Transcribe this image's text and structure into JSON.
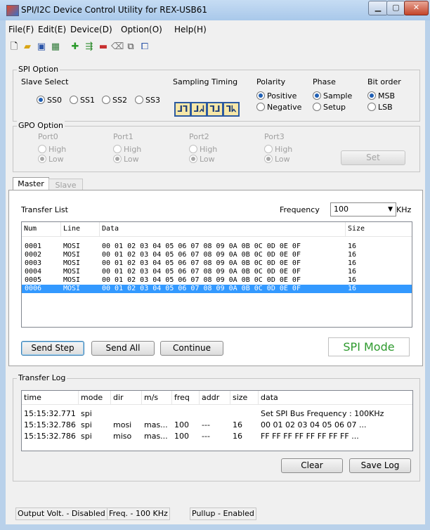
{
  "window": {
    "title": "SPI/I2C Device Control Utility for REX-USB61"
  },
  "menu": [
    "File(F)",
    "Edit(E)",
    "Device(D)",
    "Option(O)",
    "Help(H)"
  ],
  "toolbar_icons": [
    "new-file-icon",
    "open-folder-icon",
    "save-icon",
    "device-icon",
    "add-icon",
    "insert-icon",
    "remove-icon",
    "edit-icon",
    "copy-icon",
    "paste-icon"
  ],
  "spi_option": {
    "title": "SPI Option",
    "slave_select_label": "Slave Select",
    "slave_options": [
      "SS0",
      "SS1",
      "SS2",
      "SS3"
    ],
    "slave_selected": "SS0",
    "sampling_label": "Sampling Timing",
    "sampling_glyphs": [
      "ᒧᒣ",
      "ᒧᖽ",
      "ᒣᒧ",
      "ᒣᖾ"
    ],
    "polarity_label": "Polarity",
    "polarity_options": [
      "Positive",
      "Negative"
    ],
    "phase_label": "Phase",
    "phase_options": [
      "Sample",
      "Setup"
    ],
    "bitorder_label": "Bit order",
    "bitorder_options": [
      "MSB",
      "LSB"
    ]
  },
  "gpo_option": {
    "title": "GPO Option",
    "ports": [
      "Port0",
      "Port1",
      "Port2",
      "Port3"
    ],
    "high": "High",
    "low": "Low",
    "set_button": "Set"
  },
  "tabs": {
    "master": "Master",
    "slave": "Slave"
  },
  "transfer": {
    "title": "Transfer List",
    "frequency_label": "Frequency",
    "frequency_value": "100",
    "frequency_unit": "KHz",
    "columns": [
      "Num",
      "Line",
      "Data",
      "Size"
    ],
    "rows": [
      {
        "num": "0001",
        "line": "MOSI",
        "data": "00 01 02 03 04 05 06 07 08 09 0A 0B 0C 0D 0E 0F",
        "size": "16"
      },
      {
        "num": "0002",
        "line": "MOSI",
        "data": "00 01 02 03 04 05 06 07 08 09 0A 0B 0C 0D 0E 0F",
        "size": "16"
      },
      {
        "num": "0003",
        "line": "MOSI",
        "data": "00 01 02 03 04 05 06 07 08 09 0A 0B 0C 0D 0E 0F",
        "size": "16"
      },
      {
        "num": "0004",
        "line": "MOSI",
        "data": "00 01 02 03 04 05 06 07 08 09 0A 0B 0C 0D 0E 0F",
        "size": "16"
      },
      {
        "num": "0005",
        "line": "MOSI",
        "data": "00 01 02 03 04 05 06 07 08 09 0A 0B 0C 0D 0E 0F",
        "size": "16"
      },
      {
        "num": "0006",
        "line": "MOSI",
        "data": "00 01 02 03 04 05 06 07 08 09 0A 0B 0C 0D 0E 0F",
        "size": "16"
      }
    ],
    "buttons": {
      "send_step": "Send Step",
      "send_all": "Send All",
      "continue": "Continue"
    },
    "mode_label": "SPI Mode"
  },
  "log": {
    "title": "Transfer Log",
    "columns": [
      "time",
      "mode",
      "dir",
      "m/s",
      "freq",
      "addr",
      "size",
      "data"
    ],
    "rows": [
      {
        "time": "15:15:32.771",
        "mode": "spi",
        "dir": "",
        "ms": "",
        "freq": "",
        "addr": "",
        "size": "",
        "data": "Set SPI Bus Frequency : 100KHz"
      },
      {
        "time": "15:15:32.786",
        "mode": "spi",
        "dir": "mosi",
        "ms": "mas...",
        "freq": "100",
        "addr": "---",
        "size": "16",
        "data": "00 01 02 03 04 05 06 07 ..."
      },
      {
        "time": "15:15:32.786",
        "mode": "spi",
        "dir": "miso",
        "ms": "mas...",
        "freq": "100",
        "addr": "---",
        "size": "16",
        "data": "FF FF FF FF FF FF FF FF ..."
      }
    ],
    "clear_button": "Clear",
    "save_button": "Save Log"
  },
  "status": {
    "output": "Output Volt. - Disabled",
    "freq": "Freq. - 100 KHz",
    "pullup": "Pullup - Enabled"
  }
}
